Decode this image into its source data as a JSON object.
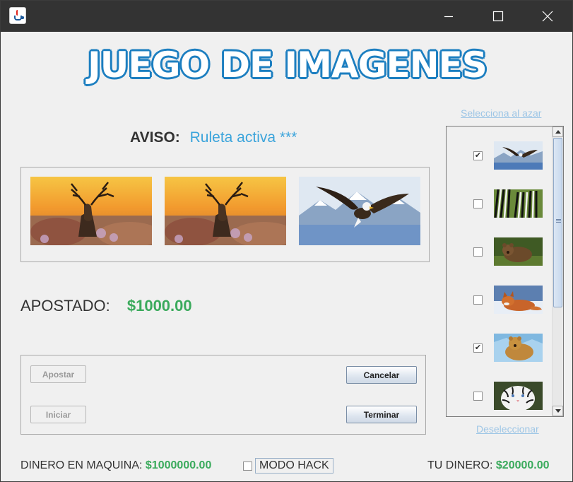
{
  "window": {
    "icon": "java-cup-icon",
    "controls": [
      "minimize-icon",
      "maximize-icon",
      "close-icon"
    ]
  },
  "header": {
    "title": "JUEGO DE IMAGENES"
  },
  "aviso": {
    "label": "AVISO:",
    "message": "Ruleta activa ***"
  },
  "slots": [
    {
      "image": "deer-sunset-image"
    },
    {
      "image": "deer-sunset-image"
    },
    {
      "image": "eagle-mountains-image"
    }
  ],
  "bet": {
    "label": "APOSTADO:",
    "amount": "$1000.00"
  },
  "buttons": {
    "apostar": "Apostar",
    "iniciar": "Iniciar",
    "cancelar": "Cancelar",
    "terminar": "Terminar"
  },
  "selector": {
    "random_link": "Selecciona al azar",
    "deselect_link": "Deseleccionar",
    "items": [
      {
        "animal": "eagle",
        "checked": true
      },
      {
        "animal": "zebras",
        "checked": false
      },
      {
        "animal": "bear",
        "checked": false
      },
      {
        "animal": "fox",
        "checked": false
      },
      {
        "animal": "brown-bear",
        "checked": true
      },
      {
        "animal": "white-tiger",
        "checked": false
      }
    ]
  },
  "footer": {
    "machine_label": "DINERO EN MAQUINA:",
    "machine_amount": "$1000000.00",
    "hack_label": "MODO HACK",
    "your_label": "TU DINERO:",
    "your_amount": "$20000.00"
  },
  "colors": {
    "accent_blue": "#3ba4db",
    "money_green": "#3aaa5c",
    "logo_outline": "#1d7fc0"
  }
}
